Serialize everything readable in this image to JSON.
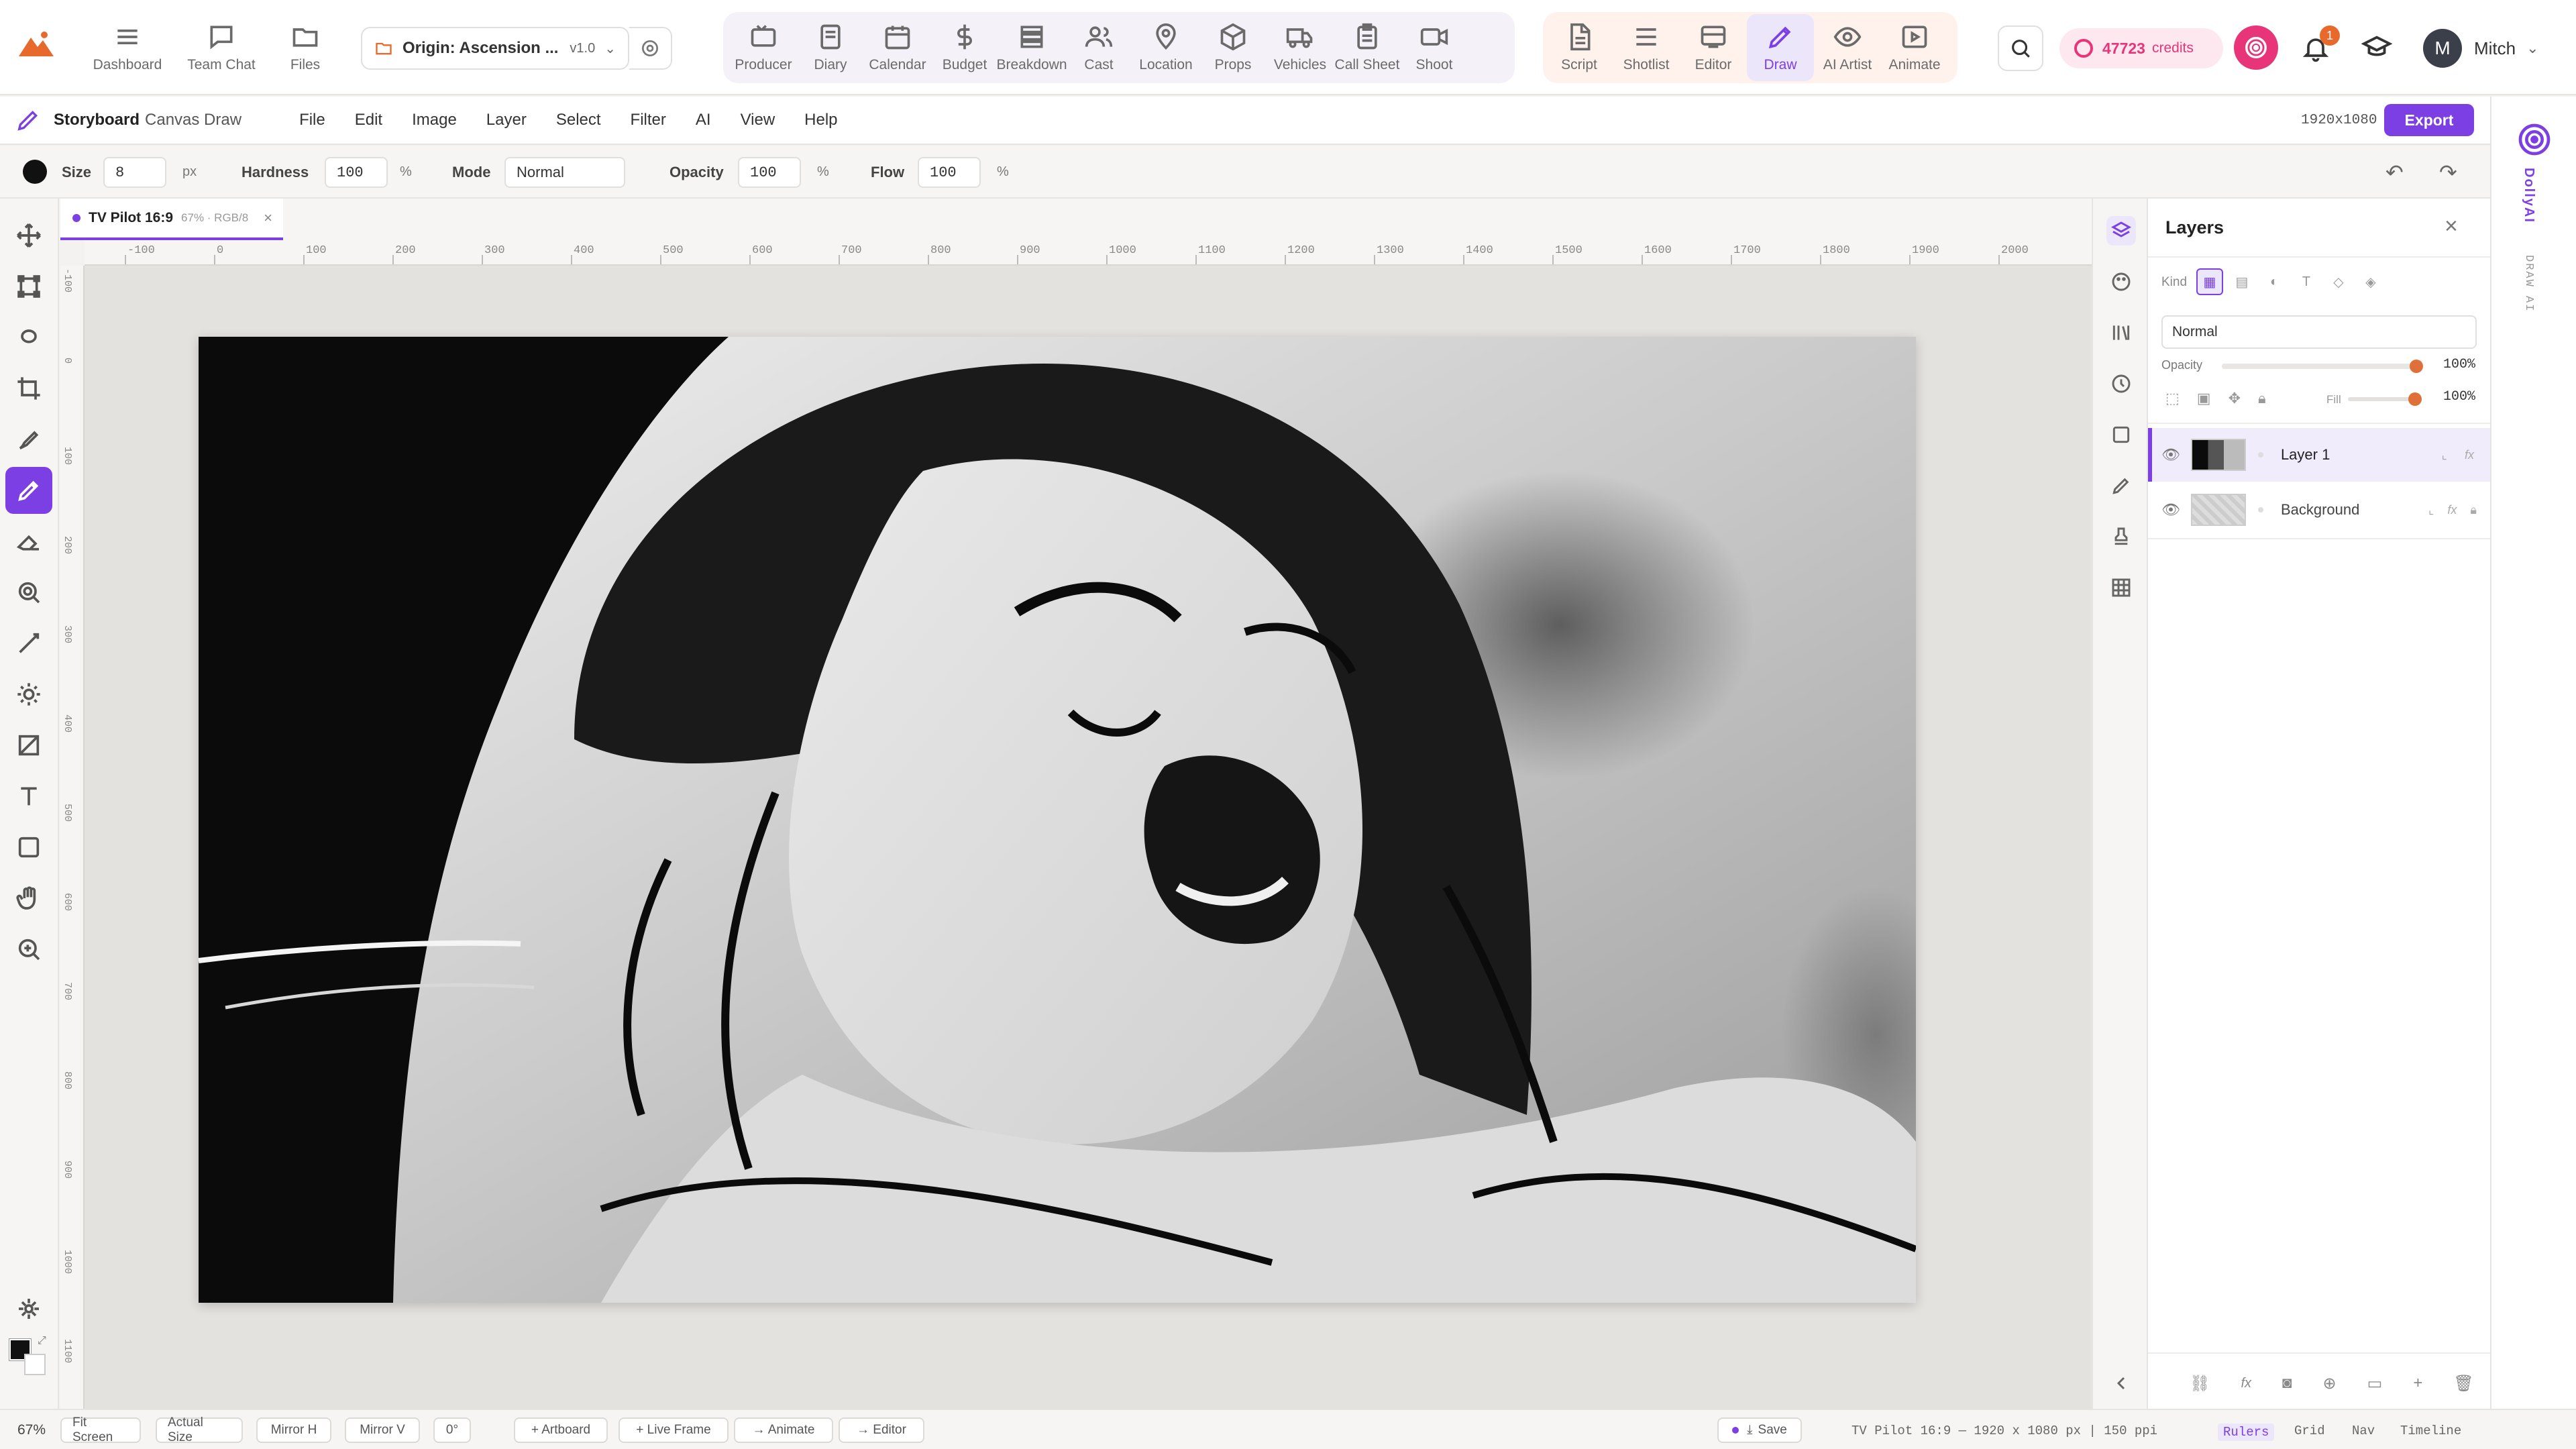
{
  "top_nav": {
    "brand_icon": "mountain-logo",
    "primary": [
      {
        "label": "Dashboard",
        "icon": "menu-icon"
      },
      {
        "label": "Team Chat",
        "icon": "chat-icon"
      },
      {
        "label": "Files",
        "icon": "folder-icon"
      }
    ],
    "project": {
      "name": "Origin: Ascension ...",
      "version": "v1.0"
    },
    "production": [
      {
        "label": "Producer"
      },
      {
        "label": "Diary"
      },
      {
        "label": "Calendar"
      },
      {
        "label": "Budget"
      },
      {
        "label": "Breakdown"
      },
      {
        "label": "Cast"
      },
      {
        "label": "Location"
      },
      {
        "label": "Props"
      },
      {
        "label": "Vehicles"
      },
      {
        "label": "Call Sheet"
      },
      {
        "label": "Shoot"
      }
    ],
    "creative": [
      {
        "label": "Script"
      },
      {
        "label": "Shotlist"
      },
      {
        "label": "Editor"
      },
      {
        "label": "Draw",
        "active": true
      },
      {
        "label": "AI Artist"
      },
      {
        "label": "Animate"
      }
    ],
    "credits": {
      "value": "47723",
      "unit": "credits"
    },
    "notifications": {
      "count": "1"
    },
    "user": {
      "initial": "M",
      "name": "Mitch"
    }
  },
  "menu_bar": {
    "title_strong": "Storyboard",
    "title_rest": "Canvas Draw",
    "items": [
      "File",
      "Edit",
      "Image",
      "Layer",
      "Select",
      "Filter",
      "AI",
      "View",
      "Help"
    ],
    "canvas_size": "1920x1080",
    "export_label": "Export"
  },
  "options_bar": {
    "size": {
      "label": "Size",
      "value": "8",
      "unit": "px"
    },
    "hardness": {
      "label": "Hardness",
      "value": "100",
      "unit": "%"
    },
    "mode": {
      "label": "Mode",
      "value": "Normal"
    },
    "opacity": {
      "label": "Opacity",
      "value": "100",
      "unit": "%"
    },
    "flow": {
      "label": "Flow",
      "value": "100",
      "unit": "%"
    }
  },
  "document_tab": {
    "name": "TV Pilot 16:9",
    "meta": "67% · RGB/8"
  },
  "rulers": {
    "h": [
      "-100",
      "0",
      "100",
      "200",
      "300",
      "400",
      "500",
      "600",
      "700",
      "800",
      "900",
      "1000",
      "1100",
      "1200",
      "1300",
      "1400",
      "1500",
      "1600",
      "1700",
      "1800",
      "1900",
      "2000"
    ],
    "v": [
      "-100",
      "0",
      "100",
      "200",
      "300",
      "400",
      "500",
      "600",
      "700",
      "800",
      "900",
      "1000",
      "1100"
    ]
  },
  "layers_panel": {
    "title": "Layers",
    "kind_label": "Kind",
    "blend_mode": "Normal",
    "opacity_label": "Opacity",
    "opacity_value": "100%",
    "opacity_level": 1.0,
    "fill_label": "Fill",
    "fill_value": "100%",
    "fill_level": 1.0,
    "layers": [
      {
        "name": "Layer 1",
        "selected": true
      },
      {
        "name": "Background",
        "selected": false,
        "locked": true
      }
    ]
  },
  "right_rail": {
    "brand": "DollyAI",
    "sub": "DRAW AI"
  },
  "status_bar": {
    "zoom": "67%",
    "buttons_left": [
      "Fit Screen",
      "Actual Size",
      "Mirror H",
      "Mirror V",
      "0°"
    ],
    "buttons_mid": [
      "+ Artboard",
      "+ Live Frame",
      "→ Animate",
      "→ Editor"
    ],
    "save_label": "Save",
    "doc_info": "TV Pilot 16:9 — 1920 x 1080 px | 150 ppi",
    "toggles": [
      "Rulers",
      "Grid",
      "Nav",
      "Timeline"
    ]
  },
  "colors": {
    "accent": "#7b3fe4",
    "credits": "#e8357a",
    "slider": "#e0703a"
  }
}
